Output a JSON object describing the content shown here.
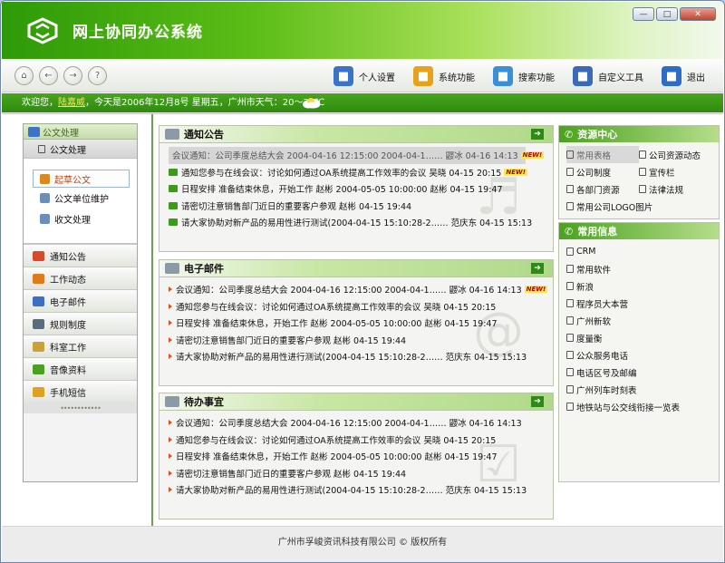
{
  "app": {
    "title": "网上协同办公系统"
  },
  "window_controls": {
    "minimize": "—",
    "maximize": "□",
    "close": "✕"
  },
  "toolbar": {
    "tools": [
      {
        "label": "个人设置",
        "icon": "person-settings-icon",
        "color": "#3a73c7"
      },
      {
        "label": "系统功能",
        "icon": "gear-icon",
        "color": "#e8a21a"
      },
      {
        "label": "搜索功能",
        "icon": "search-icon",
        "color": "#3a8fd6"
      },
      {
        "label": "自定义工具",
        "icon": "custom-tool-icon",
        "color": "#3b6bb8"
      },
      {
        "label": "退出",
        "icon": "logout-icon",
        "color": "#2f6cc4"
      }
    ]
  },
  "info": {
    "prefix": "欢迎您，",
    "user": "陆嘉威",
    "suffix": "，今天是2006年12月8号  星期五，广州市天气：20～26℃"
  },
  "sidebar": {
    "header": "公文处理",
    "open_menu": "公文处理",
    "subitems": [
      "起草公文",
      "公文单位维护",
      "收文处理"
    ],
    "menu": [
      {
        "label": "通知公告",
        "color": "#d84a2a"
      },
      {
        "label": "工作动态",
        "color": "#e07b1a"
      },
      {
        "label": "电子邮件",
        "color": "#3c6fc4"
      },
      {
        "label": "规则制度",
        "color": "#5a6b7a"
      },
      {
        "label": "科室工作",
        "color": "#c9a33a"
      },
      {
        "label": "音像资料",
        "color": "#4aa020"
      },
      {
        "label": "手机短信",
        "color": "#e0a020"
      }
    ],
    "footer": "••••••••••••"
  },
  "panels": [
    {
      "title": "通知公告",
      "bullet": "spk",
      "rows": [
        {
          "text": "会议通知：公司季度总结大会 2004-04-16 12:15:00 2004-04-1……  鼹冰 04-16 14:13",
          "new": true,
          "highlight": true
        },
        {
          "text": "通知您参与在线会议：讨论如何通过OA系统提高工作效率的会议  吴晓  04-15 20:15",
          "new": true,
          "highlight": false
        },
        {
          "text": "日程安排  准备结束休息，开始工作  赵彬  2004-05-05 10:00:00  赵彬 04-15 19:47",
          "new": false,
          "highlight": false
        },
        {
          "text": "请密切注意销售部门近日的重要客户参观  赵彬  04-15 19:44",
          "new": false,
          "highlight": false
        },
        {
          "text": "请大家协助对新产品的易用性进行测试(2004-04-15 15:10:28-2……  范庆东  04-15 15:13",
          "new": false,
          "highlight": false
        }
      ]
    },
    {
      "title": "电子邮件",
      "bullet": "tri",
      "rows": [
        {
          "text": "会议通知：公司季度总结大会  2004-04-16 12:15:00 2004-04-1……  鼹冰  04-16 14:13",
          "new": true,
          "highlight": false
        },
        {
          "text": "通知您参与在线会议：讨论如何通过OA系统提高工作效率的会议  吴晓  04-15 20:15",
          "new": false,
          "highlight": false
        },
        {
          "text": "日程安排  准备结束休息，开始工作  赵彬  2004-05-05 10:00:00  赵彬 04-15 19:47",
          "new": false,
          "highlight": false
        },
        {
          "text": "请密切注意销售部门近日的重要客户参观  赵彬  04-15 19:44",
          "new": false,
          "highlight": false
        },
        {
          "text": "请大家协助对新产品的易用性进行测试(2004-04-15 15:10:28-2……  范庆东  04-15 15:13",
          "new": false,
          "highlight": false
        }
      ]
    },
    {
      "title": "待办事宜",
      "bullet": "tri",
      "rows": [
        {
          "text": "会议通知：公司季度总结大会  2004-04-16 12:15:00 2004-04-1……  鼹冰  04-16 14:13",
          "new": false,
          "highlight": false
        },
        {
          "text": "通知您参与在线会议：讨论如何通过OA系统提高工作效率的会议  吴晓  04-15 20:15",
          "new": false,
          "highlight": false
        },
        {
          "text": "日程安排  准备结束休息，开始工作  赵彬  2004-05-05 10:00:00  赵彬 04-15 19:47",
          "new": false,
          "highlight": false
        },
        {
          "text": "请密切注意销售部门近日的重要客户参观  赵彬  04-15 19:44",
          "new": false,
          "highlight": false
        },
        {
          "text": "请大家协助对新产品的易用性进行测试(2004-04-15 15:10:28-2……  范庆东  04-15 15:13",
          "new": false,
          "highlight": false
        }
      ]
    }
  ],
  "resources": {
    "title": "资源中心",
    "items": [
      "常用表格",
      "公司资源动态",
      "公司制度",
      "宣传栏",
      "各部门资源",
      "法律法规",
      "常用公司LOGO图片"
    ]
  },
  "common_info": {
    "title": "常用信息",
    "items": [
      "CRM",
      "常用软件",
      "新浪",
      "程序员大本营",
      "广州新软",
      "度量衡",
      "公众服务电话",
      "电话区号及邮编",
      "广州列车时刻表",
      "地铁站与公交线衔接一览表"
    ]
  },
  "new_badge": "NEW!",
  "footer": {
    "text": "广州市孚峻资讯科技有限公司 © 版权所有"
  }
}
